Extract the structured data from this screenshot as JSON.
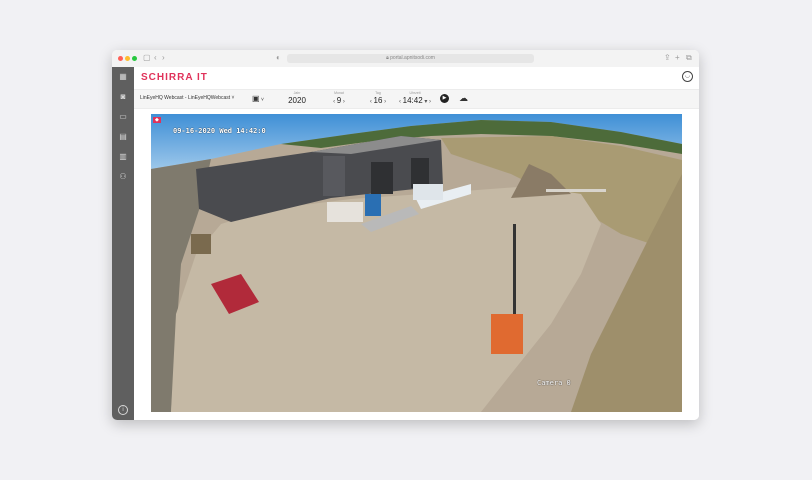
{
  "browser": {
    "url": "portal.apnitsodi.com"
  },
  "app": {
    "logo": "SCHIRRA IT"
  },
  "toolbar": {
    "camera_select": "LinEyeHQ Webcast - LinEyeHQWebcast",
    "year": {
      "label": "Jahr",
      "value": "2020"
    },
    "month": {
      "label": "Monat",
      "value": "9"
    },
    "day": {
      "label": "Tag",
      "value": "16"
    },
    "time": {
      "label": "Uhrzeit",
      "value": "14:42"
    }
  },
  "viewer": {
    "timestamp": "09-16-2020 Wed 14:42:0",
    "camera_label": "Camera 0"
  },
  "icons": {
    "sidebar": [
      "dashboard-icon",
      "camera-icon",
      "folder-icon",
      "calendar-icon",
      "book-icon",
      "users-icon"
    ],
    "accent": "#e0325a"
  }
}
